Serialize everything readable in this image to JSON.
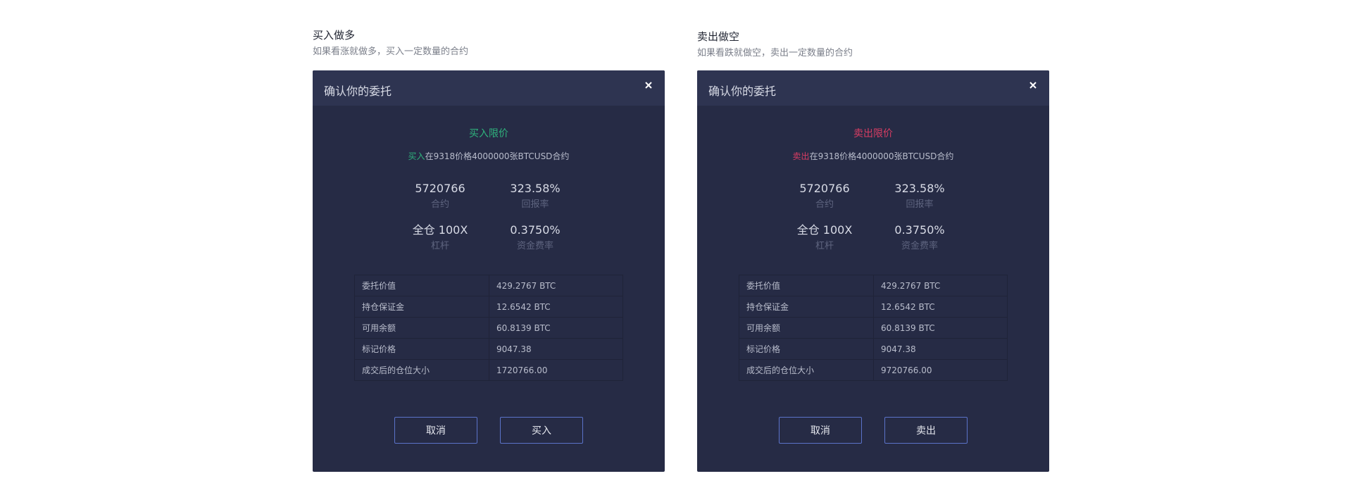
{
  "panels": [
    {
      "intro_title": "买入做多",
      "intro_desc": "如果看涨就做多，买入一定数量的合约",
      "dialog_title": "确认你的委托",
      "order_type": "买入限价",
      "order_side": "买入",
      "order_rest": "在9318价格4000000张BTCUSD合约",
      "stats": [
        {
          "value": "5720766",
          "label": "合约"
        },
        {
          "value": "323.58%",
          "label": "回报率"
        },
        {
          "value": "全仓 100X",
          "label": "杠杆"
        },
        {
          "value": "0.3750%",
          "label": "资金费率"
        }
      ],
      "rows": [
        {
          "key": "委托价值",
          "value": "429.2767 BTC"
        },
        {
          "key": "持仓保证金",
          "value": "12.6542 BTC"
        },
        {
          "key": "可用余额",
          "value": "60.8139 BTC"
        },
        {
          "key": "标记价格",
          "value": "9047.38"
        },
        {
          "key": "成交后的仓位大小",
          "value": "1720766.00"
        }
      ],
      "cancel_label": "取消",
      "confirm_label": "买入",
      "accent_color": "#2fb37d"
    },
    {
      "intro_title": "卖出做空",
      "intro_desc": "如果看跌就做空，卖出一定数量的合约",
      "dialog_title": "确认你的委托",
      "order_type": "卖出限价",
      "order_side": "卖出",
      "order_rest": "在9318价格4000000张BTCUSD合约",
      "stats": [
        {
          "value": "5720766",
          "label": "合约"
        },
        {
          "value": "323.58%",
          "label": "回报率"
        },
        {
          "value": "全仓 100X",
          "label": "杠杆"
        },
        {
          "value": "0.3750%",
          "label": "资金费率"
        }
      ],
      "rows": [
        {
          "key": "委托价值",
          "value": "429.2767 BTC"
        },
        {
          "key": "持仓保证金",
          "value": "12.6542 BTC"
        },
        {
          "key": "可用余额",
          "value": "60.8139 BTC"
        },
        {
          "key": "标记价格",
          "value": "9047.38"
        },
        {
          "key": "成交后的仓位大小",
          "value": "9720766.00"
        }
      ],
      "cancel_label": "取消",
      "confirm_label": "卖出",
      "accent_color": "#d93d63"
    }
  ],
  "icons": {
    "close": "close-icon"
  },
  "colors": {
    "dialog_bg": "#262b45",
    "header_bg": "#2e3451",
    "button_border": "#5b73c9"
  }
}
